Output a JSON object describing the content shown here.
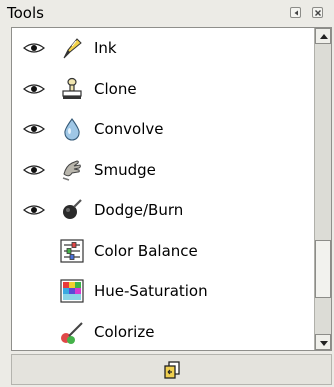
{
  "panel": {
    "title": "Tools"
  },
  "tools": [
    {
      "label": "Ink",
      "visible": true,
      "icon": "ink-pen-icon"
    },
    {
      "label": "Clone",
      "visible": true,
      "icon": "clone-stamp-icon"
    },
    {
      "label": "Convolve",
      "visible": true,
      "icon": "convolve-drop-icon"
    },
    {
      "label": "Smudge",
      "visible": true,
      "icon": "smudge-hand-icon"
    },
    {
      "label": "Dodge/Burn",
      "visible": true,
      "icon": "dodge-burn-icon"
    },
    {
      "label": "Color Balance",
      "visible": false,
      "icon": "color-balance-icon"
    },
    {
      "label": "Hue-Saturation",
      "visible": false,
      "icon": "hue-saturation-icon"
    },
    {
      "label": "Colorize",
      "visible": false,
      "icon": "colorize-icon"
    }
  ],
  "colors": {
    "background": "#ecebe6",
    "list_background": "#ffffff"
  }
}
